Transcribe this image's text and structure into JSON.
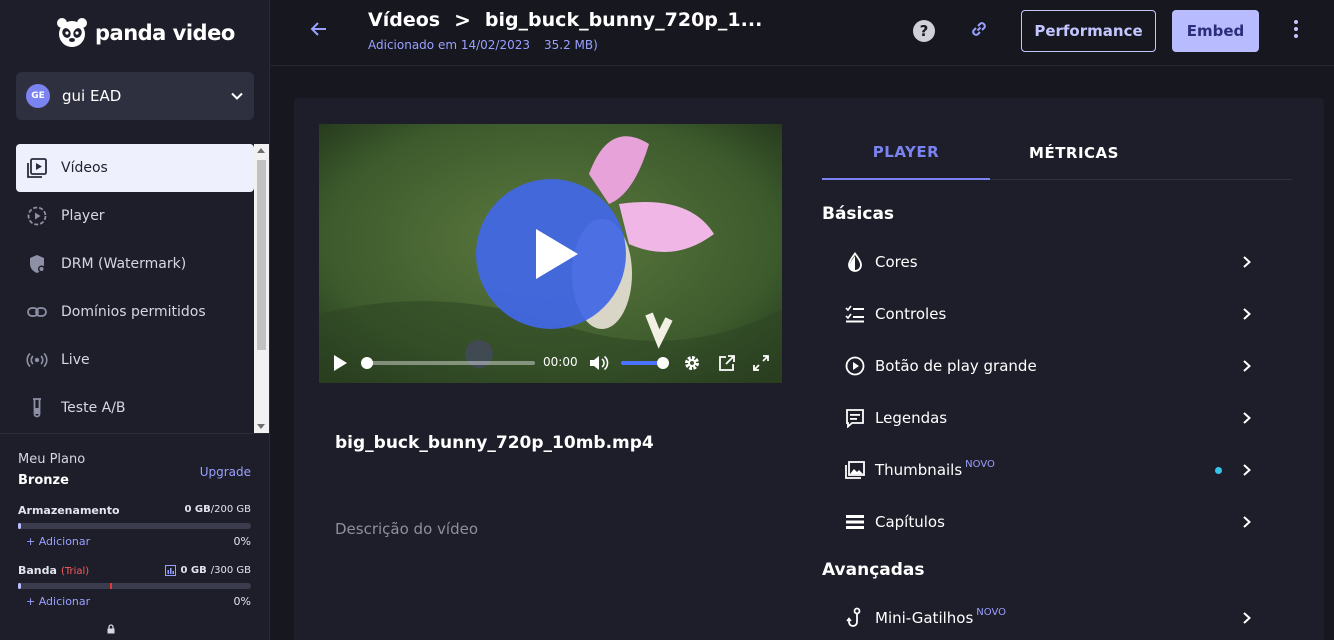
{
  "brand": {
    "logo_text": "panda video"
  },
  "account": {
    "initials": "GE",
    "name": "gui EAD"
  },
  "sidebar": {
    "items": [
      {
        "label": "Vídeos",
        "icon": "video-library-icon",
        "active": true
      },
      {
        "label": "Player",
        "icon": "player-icon",
        "active": false
      },
      {
        "label": "DRM (Watermark)",
        "icon": "shield-icon",
        "active": false
      },
      {
        "label": "Domínios permitidos",
        "icon": "link-icon",
        "active": false
      },
      {
        "label": "Live",
        "icon": "live-icon",
        "active": false
      },
      {
        "label": "Teste A/B",
        "icon": "test-tube-icon",
        "active": false
      }
    ]
  },
  "plan": {
    "title": "Meu Plano",
    "name": "Bronze",
    "upgrade": "Upgrade",
    "storage": {
      "label": "Armazenamento",
      "used": "0 GB",
      "total": "/200 GB",
      "add": "+ Adicionar",
      "pct": "0%"
    },
    "band": {
      "label": "Banda",
      "trial": "(Trial)",
      "used": "0 GB",
      "total": "/300 GB",
      "add": "+ Adicionar",
      "pct": "0%"
    }
  },
  "header": {
    "crumb_root": "Vídeos",
    "crumb_sep": ">",
    "crumb_current": "big_buck_bunny_720p_1...",
    "added": "Adicionado em 14/02/2023",
    "size": "35.2 MB)",
    "help": "?",
    "performance": "Performance",
    "embed": "Embed"
  },
  "player": {
    "time": "00:00",
    "progress": 0.0,
    "volume": 1.0
  },
  "video": {
    "title": "big_buck_bunny_720p_10mb.mp4",
    "description_placeholder": "Descrição do vídeo"
  },
  "tabs": {
    "player": "PLAYER",
    "metrics": "MÉTRICAS"
  },
  "sections": {
    "basic": "Básicas",
    "advanced": "Avançadas",
    "options": [
      {
        "label": "Cores",
        "icon": "drop-icon",
        "new": ""
      },
      {
        "label": "Controles",
        "icon": "controls-icon",
        "new": ""
      },
      {
        "label": "Botão de play grande",
        "icon": "play-circle-icon",
        "new": ""
      },
      {
        "label": "Legendas",
        "icon": "subtitles-icon",
        "new": ""
      },
      {
        "label": "Thumbnails",
        "icon": "image-icon",
        "new": "NOVO"
      },
      {
        "label": "Capítulos",
        "icon": "chapters-icon",
        "new": ""
      }
    ],
    "advanced_options": [
      {
        "label": "Mini-Gatilhos",
        "icon": "hook-icon",
        "new": "NOVO"
      }
    ]
  }
}
